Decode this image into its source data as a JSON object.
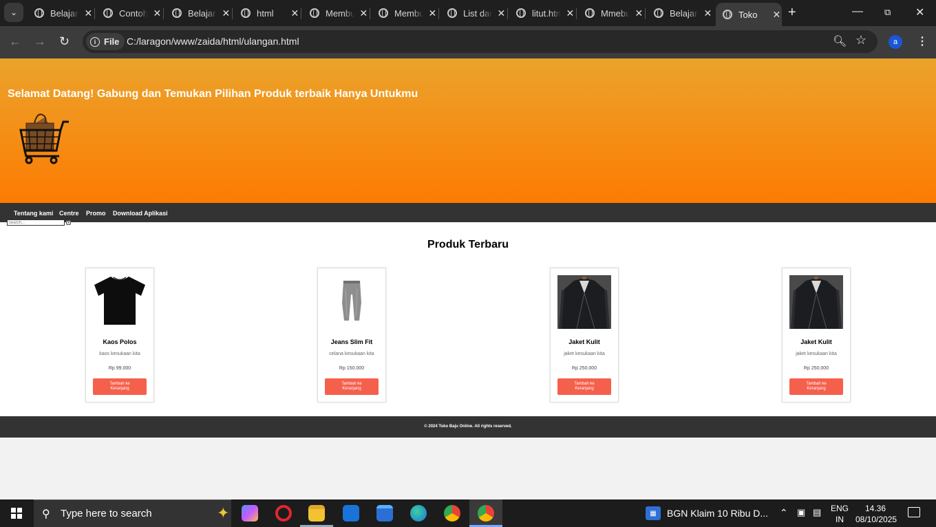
{
  "browser": {
    "tabs": [
      {
        "label": "Belajar"
      },
      {
        "label": "Contoh"
      },
      {
        "label": "Belajar"
      },
      {
        "label": "html"
      },
      {
        "label": "Membuat"
      },
      {
        "label": "Membuat"
      },
      {
        "label": "List dan"
      },
      {
        "label": "litut.html"
      },
      {
        "label": "Mmebuat"
      },
      {
        "label": "Belajar"
      },
      {
        "label": "Toko"
      }
    ],
    "active_tab_index": 10,
    "address": {
      "chip_label": "File",
      "url": "C:/laragon/www/zaida/html/ulangan.html"
    },
    "profile_initial": "a"
  },
  "page": {
    "hero_title": "Selamat Datang! Gabung dan Temukan Pilihan Produk terbaik Hanya Untukmu",
    "nav_links": [
      "Tentang kami",
      "Centre",
      "Promo",
      "Download Aplikasi"
    ],
    "search_placeholder": "Search...",
    "section_title": "Produk Terbaru",
    "products": [
      {
        "name": "Kaos Polos",
        "desc": "kaos kesukaan kita",
        "price": "Rp 99.000",
        "button": "Tambah ke Keranjang",
        "image": "tshirt-image"
      },
      {
        "name": "Jeans Slim Fit",
        "desc": "celana kesukaan kita",
        "price": "Rp 150.000",
        "button": "Tambah ke Keranjang",
        "image": "jeans-image"
      },
      {
        "name": "Jaket Kulit",
        "desc": "jaket kesukaan kita",
        "price": "Rp 250.000",
        "button": "Tambah ke Keranjang",
        "image": "leather-jacket-image"
      },
      {
        "name": "Jaket Kulit",
        "desc": "jaket kesukaan kita",
        "price": "Rp 250.000",
        "button": "Tambah ke Keranjang",
        "image": "leather-jacket-image"
      }
    ],
    "footer": "© 2024 Toko Baju Online. All rights reserved.",
    "colors": {
      "hero_top": "#eba32b",
      "hero_bottom": "#fd7b03",
      "nav_bg": "#333333",
      "button": "#f5604c"
    }
  },
  "taskbar": {
    "search_placeholder": "Type here to search",
    "news": "BGN Klaim 10 Ribu D...",
    "lang_top": "ENG",
    "lang_bottom": "IN",
    "time": "14.36",
    "date": "08/10/2025"
  }
}
